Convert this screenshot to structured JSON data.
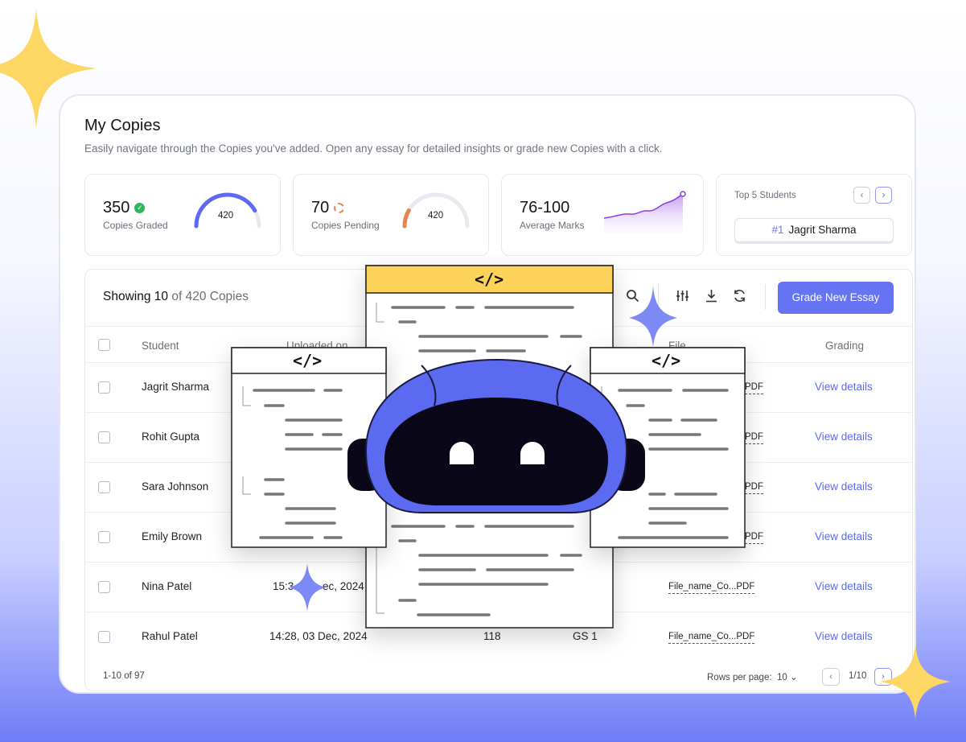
{
  "header": {
    "title": "My Copies",
    "subtitle": "Easily navigate through the Copies you've added. Open any essay for detailed insights or grade new Copies with a click."
  },
  "stats": {
    "graded": {
      "value": "350",
      "label": "Copies Graded",
      "gauge_total": "420",
      "gauge_fraction": 0.833,
      "color": "#5b6af0"
    },
    "pending": {
      "value": "70",
      "label": "Copies Pending",
      "gauge_total": "420",
      "gauge_fraction": 0.167,
      "color": "#e8844d"
    },
    "average": {
      "value": "76-100",
      "label": "Average Marks"
    },
    "top_students": {
      "title": "Top 5 Students",
      "rank": "#1",
      "name": "Jagrit Sharma"
    }
  },
  "table": {
    "showing_prefix": "Showing",
    "showing_count": "10",
    "showing_suffix": "of 420 Copies",
    "grade_button": "Grade New Essay",
    "columns": [
      "Student",
      "Uploaded on",
      "File",
      "Grading"
    ],
    "rows": [
      {
        "student": "Jagrit Sharma",
        "file": "PDF",
        "grading": "View details"
      },
      {
        "student": "Rohit Gupta",
        "file": "PDF",
        "grading": "View details"
      },
      {
        "student": "Sara Johnson",
        "file": "PDF",
        "grading": "View details"
      },
      {
        "student": "Emily Brown",
        "file": "PDF",
        "grading": "View details"
      },
      {
        "student": "Nina Patel",
        "uploaded_prefix": "15:3",
        "uploaded_suffix": "ec, 2024",
        "file": "File_name_Co...PDF",
        "grading": "View details"
      },
      {
        "student": "Rahul Patel",
        "uploaded": "14:28, 03 Dec, 2024",
        "marks": "118",
        "paper": "GS 1",
        "file": "File_name_Co...PDF",
        "grading": "View details"
      }
    ],
    "range": "1-10 of 97",
    "rows_per_page_label": "Rows per page:",
    "rows_per_page": "10",
    "page": "1/10"
  },
  "overlay": {
    "code_tag": "</>",
    "colors": {
      "robot": "#5b6af0",
      "robot_face": "#0a0818",
      "sparkle_yellow": "#fdd663",
      "sparkle_blue": "#7d8af5",
      "code_header": "#fcd25a"
    }
  }
}
